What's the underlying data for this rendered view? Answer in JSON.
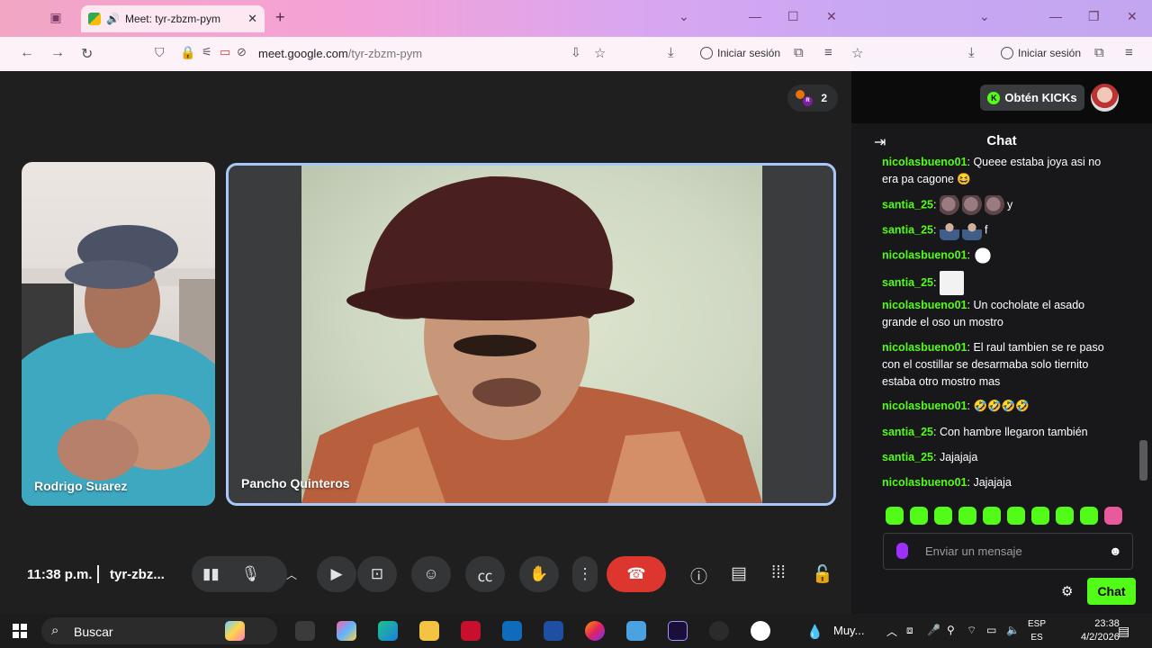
{
  "meet_browser": {
    "tab_title": "Meet: tyr-zbzm-pym",
    "url_host": "meet.google.com",
    "url_path": "/tyr-zbzm-pym",
    "sign_in": "Iniciar sesión"
  },
  "meet": {
    "participant_count": "2",
    "tiles": [
      {
        "name": "Rodrigo Suarez"
      },
      {
        "name": "Pancho Quinteros"
      }
    ],
    "time": "11:38 p.m.",
    "meeting_code": "tyr-zbz...",
    "controls": [
      "audio-levels",
      "microphone",
      "more-options-arrow",
      "camera",
      "present",
      "emoji",
      "captions",
      "raise-hand",
      "more",
      "leave-call",
      "info",
      "chat",
      "activities",
      "host-controls"
    ]
  },
  "kick_browser": {
    "sign_in": "Iniciar sesión"
  },
  "kick": {
    "get_kicks": "Obtén KICKs",
    "chat_title": "Chat",
    "messages": [
      {
        "user": "nicolasbueno01",
        "text": "Queee estaba joya asi no era pa cagone 😆"
      },
      {
        "user": "santia_25",
        "text": "y"
      },
      {
        "user": "santia_25",
        "text": "f"
      },
      {
        "user": "nicolasbueno01",
        "text": ""
      },
      {
        "user": "santia_25",
        "text": ""
      },
      {
        "user": "nicolasbueno01",
        "text": "Un cocholate el asado grande el oso un mostro"
      },
      {
        "user": "nicolasbueno01",
        "text": "El raul tambien se re paso con el costillar se desarmaba solo tiernito estaba otro mostro mas"
      },
      {
        "user": "nicolasbueno01",
        "text": "🤣🤣🤣🤣"
      },
      {
        "user": "santia_25",
        "text": "Con hambre llegaron también"
      },
      {
        "user": "santia_25",
        "text": "Jajajaja"
      },
      {
        "user": "nicolasbueno01",
        "text": "Jajajaja"
      }
    ],
    "input_placeholder": "Enviar un mensaje",
    "send_label": "Chat"
  },
  "taskbar": {
    "search_label": "Buscar",
    "weather_text": "Muy...",
    "language": "ESP",
    "language_sub": "ES",
    "time": "23:38",
    "date": "4/2/2026"
  },
  "colors": {
    "kick_green": "#53fc18",
    "meet_end_call": "#dc362e",
    "active_tile_border": "#a8c7fa"
  }
}
